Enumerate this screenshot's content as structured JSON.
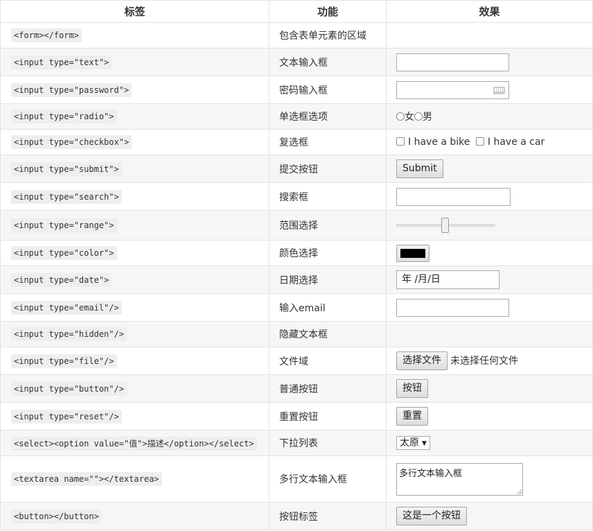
{
  "header": {
    "col1": "标签",
    "col2": "功能",
    "col3": "效果"
  },
  "rows": [
    {
      "tag": "<form></form>",
      "desc": "包含表单元素的区域"
    },
    {
      "tag": "<input type=\"text\">",
      "desc": "文本输入框"
    },
    {
      "tag": "<input type=\"password\">",
      "desc": "密码输入框"
    },
    {
      "tag": "<input type=\"radio\">",
      "desc": "单选框选项"
    },
    {
      "tag": "<input type=\"checkbox\">",
      "desc": "复选框"
    },
    {
      "tag": "<input type=\"submit\">",
      "desc": "提交按钮"
    },
    {
      "tag": "<input type=\"search\">",
      "desc": "搜索框"
    },
    {
      "tag": "<input type=\"range\">",
      "desc": "范围选择"
    },
    {
      "tag": "<input type=\"color\">",
      "desc": "颜色选择"
    },
    {
      "tag": "<input type=\"date\">",
      "desc": "日期选择"
    },
    {
      "tag": "<input type=\"email\"/>",
      "desc": "输入email"
    },
    {
      "tag": "<input type=\"hidden\"/>",
      "desc": "隐藏文本框"
    },
    {
      "tag": "<input type=\"file\"/>",
      "desc": "文件域"
    },
    {
      "tag": "<input type=\"button\"/>",
      "desc": "普通按钮"
    },
    {
      "tag": "<input type=\"reset\"/>",
      "desc": "重置按钮"
    },
    {
      "tag": "<select><option value=\"值\">描述</option></select>",
      "desc": "下拉列表"
    },
    {
      "tag": "<textarea name=\"\"></textarea>",
      "desc": "多行文本输入框"
    },
    {
      "tag": "<button></button>",
      "desc": "按钮标签"
    }
  ],
  "demos": {
    "radio": {
      "option1": "女",
      "option2": "男"
    },
    "checkbox": {
      "option1": "I have a bike",
      "option2": "I have a car"
    },
    "submit_label": "Submit",
    "range_value_fraction": 0.49,
    "color_value": "#000000",
    "date_placeholder": "年 /月/日",
    "file": {
      "button": "选择文件",
      "status": "未选择任何文件"
    },
    "button_label": "按钮",
    "reset_label": "重置",
    "select_value": "太原",
    "textarea_value": "多行文本输入框",
    "button_tag_label": "这是一个按钮"
  }
}
